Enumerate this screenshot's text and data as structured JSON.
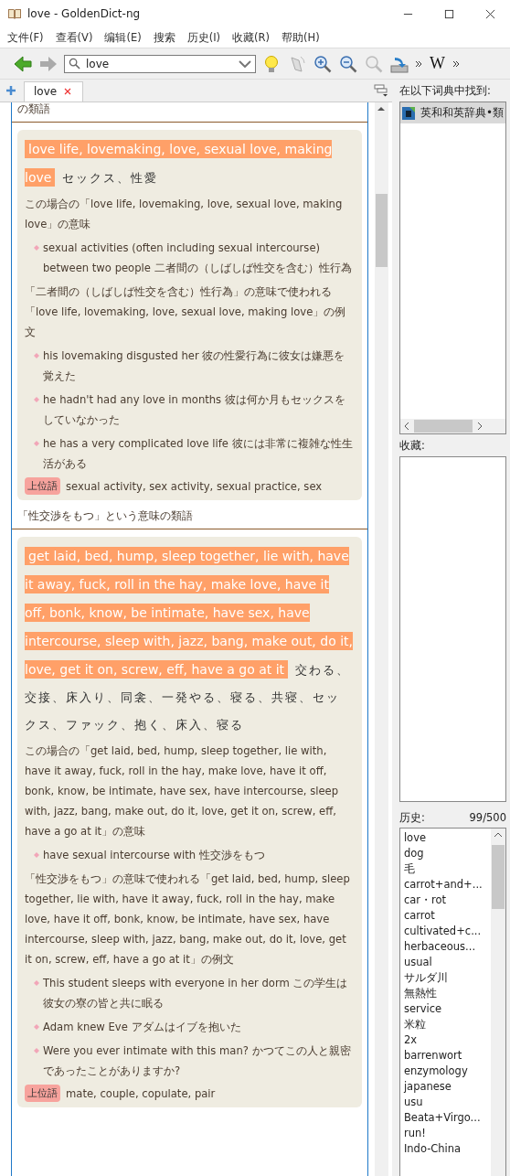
{
  "window": {
    "title": "love - GoldenDict-ng"
  },
  "menu": [
    "文件(F)",
    "查看(V)",
    "编辑(E)",
    "搜索",
    "历史(I)",
    "收藏(R)",
    "帮助(H)"
  ],
  "toolbar": {
    "search": {
      "value": "love"
    },
    "wiki_label": "W"
  },
  "tabs": [
    {
      "label": "love",
      "selected": true
    }
  ],
  "article": [
    {
      "kind": "heading",
      "text": "の類語"
    },
    {
      "kind": "card",
      "headword": "love life, lovemaking, love, sexual love, making love",
      "translation": "セックス、性愛",
      "meaning": "この場合の「love life, lovemaking, love, sexual love, making love」の意味",
      "senses": [
        "sexual activities (often including sexual intercourse) between two people 二者間の（しばしば性交を含む）性行為"
      ],
      "usage": "「二者間の（しばしば性交を含む）性行為」の意味で使われる「love life, lovemaking, love, sexual love, making love」の例文",
      "examples": [
        "his lovemaking disgusted her 彼の性愛行為に彼女は嫌悪を覚えた",
        "he hadn't had any love in months 彼は何か月もセックスをしていなかった",
        "he has a very complicated love life 彼には非常に複雑な性生活がある"
      ],
      "hypernym_label": "上位語",
      "hypernym": "sexual activity, sex activity, sexual practice, sex"
    },
    {
      "kind": "heading",
      "text": "「性交渉をもつ」という意味の類語"
    },
    {
      "kind": "card",
      "headword": "get laid, bed, hump, sleep together, lie with, have it away, fuck, roll in the hay, make love, have it off, bonk, know, be intimate, have sex, have intercourse, sleep with, jazz, bang, make out, do it, love, get it on, screw, eff, have a go at it",
      "translation": "交わる、交接、床入り、同衾、一発やる、寝る、共寝、セックス、ファック、抱く、床入、寝る",
      "meaning": "この場合の「get laid, bed, hump, sleep together, lie with, have it away, fuck, roll in the hay, make love, have it off, bonk, know, be intimate, have sex, have intercourse, sleep with, jazz, bang, make out, do it, love, get it on, screw, eff, have a go at it」の意味",
      "senses": [
        "have sexual intercourse with 性交渉をもつ"
      ],
      "usage": "「性交渉をもつ」の意味で使われる「get laid, bed, hump, sleep together, lie with, have it away, fuck, roll in the hay, make love, have it off, bonk, know, be intimate, have sex, have intercourse, sleep with, jazz, bang, make out, do it, love, get it on, screw, eff, have a go at it」の例文",
      "examples": [
        "This student sleeps with everyone in her dorm この学生は彼女の寮の皆と共に眠る",
        "Adam knew Eve アダムはイブを抱いた",
        "Were you ever intimate with this man? かつてこの人と親密であったことがありますか?"
      ],
      "hypernym_label": "上位語",
      "hypernym": "mate, couple, copulate, pair"
    }
  ],
  "found_in": {
    "label": "在以下词典中找到:",
    "items": [
      {
        "name": "英和和英辞典•類",
        "selected": true
      }
    ]
  },
  "favorites": {
    "label": "收藏:"
  },
  "history": {
    "label": "历史:",
    "count": "99/500",
    "items": [
      "love",
      "dog",
      "毛",
      "carrot+and+...",
      "car・rot",
      "carrot",
      "cultivated+c...",
      "herbaceous...",
      "usual",
      "サルダ川",
      "無熱性",
      "service",
      "米粒",
      "2x",
      "barrenwort",
      "enzymology",
      "japanese",
      "usu",
      "Beata+Virgo...",
      "run!",
      "Indo-China"
    ]
  }
}
